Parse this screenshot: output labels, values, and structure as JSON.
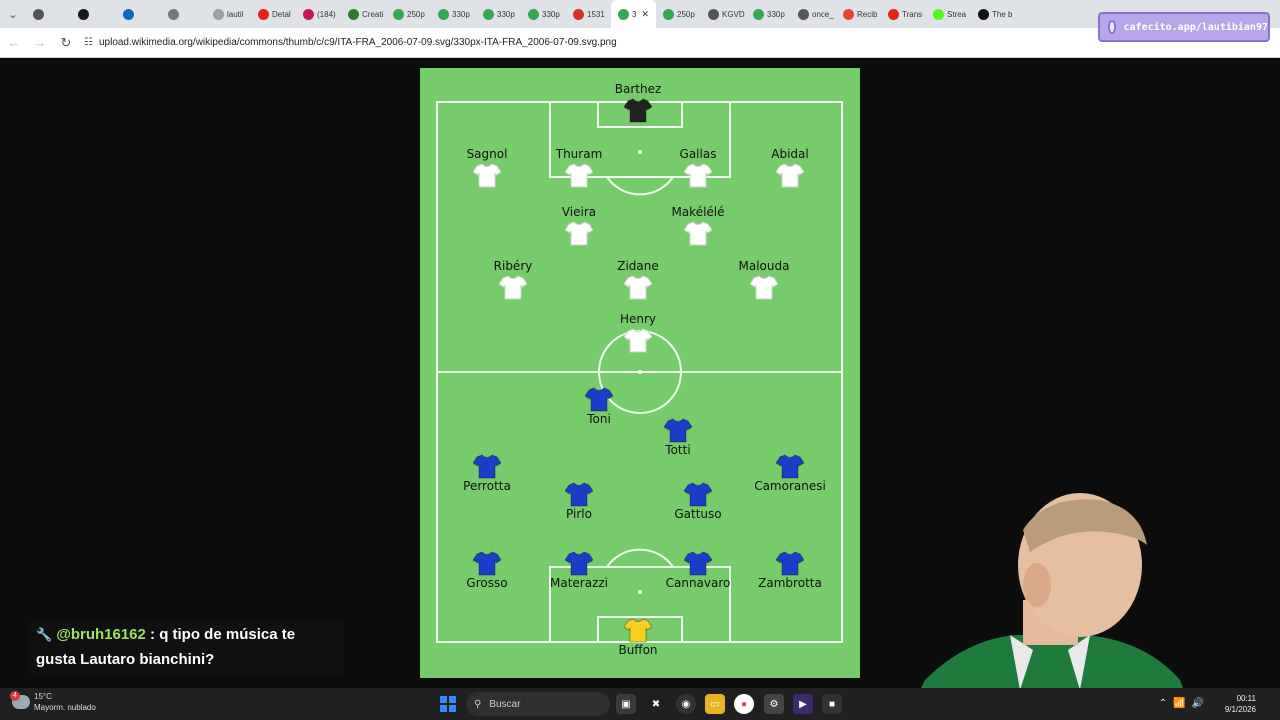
{
  "browser": {
    "tabs": [
      {
        "title": "",
        "icon": "gear-icon",
        "color": "#555555"
      },
      {
        "title": "",
        "icon": "page-icon",
        "color": "#1a1a1a"
      },
      {
        "title": "",
        "icon": "linkedin-icon",
        "color": "#0a66c2"
      },
      {
        "title": "",
        "icon": "info-icon",
        "color": "#777777"
      },
      {
        "title": "lautil",
        "icon": "page-icon",
        "color": "#9aa0a6"
      },
      {
        "title": "Detal",
        "icon": "youtube-icon",
        "color": "#e62117"
      },
      {
        "title": "(184)",
        "icon": "app-icon",
        "color": "#c2185b"
      },
      {
        "title": "Creati",
        "icon": "page-icon",
        "color": "#2e7d32"
      },
      {
        "title": "250p",
        "icon": "wiki-icon",
        "color": "#34a853"
      },
      {
        "title": "330p",
        "icon": "wiki-icon",
        "color": "#34a853"
      },
      {
        "title": "330p",
        "icon": "wiki-icon",
        "color": "#34a853"
      },
      {
        "title": "330p",
        "icon": "wiki-icon",
        "color": "#34a853"
      },
      {
        "title": "1531",
        "icon": "mail-icon",
        "color": "#d93025"
      },
      {
        "title": "3",
        "icon": "wiki-icon",
        "color": "#34a853",
        "active": true
      },
      {
        "title": "250p",
        "icon": "wiki-icon",
        "color": "#34a853"
      },
      {
        "title": "KGVD",
        "icon": "page-icon",
        "color": "#555555"
      },
      {
        "title": "330p",
        "icon": "wiki-icon",
        "color": "#34a853"
      },
      {
        "title": "once_",
        "icon": "page-icon",
        "color": "#555555"
      },
      {
        "title": "Recib",
        "icon": "gmail-icon",
        "color": "#ea4335"
      },
      {
        "title": "Trans",
        "icon": "youtube-icon",
        "color": "#e62117"
      },
      {
        "title": "Strea",
        "icon": "kick-icon",
        "color": "#53fc18"
      },
      {
        "title": "The b",
        "icon": "page-icon",
        "color": "#111111"
      }
    ],
    "url": "upload.wikimedia.org/wikipedia/commons/thumb/c/c9/ITA-FRA_2006-07-09.svg/330px-ITA-FRA_2006-07-09.svg.png"
  },
  "extension_badge": "cafecito.app/lautibian97",
  "lineup": {
    "pitch_color": "#76cb6a",
    "line_color": "#ffffff",
    "players": [
      {
        "name": "Barthez",
        "team": "FRA-GK",
        "shirt_color": "#222222"
      },
      {
        "name": "Sagnol",
        "team": "FRA",
        "shirt_color": "#ffffff"
      },
      {
        "name": "Thuram",
        "team": "FRA",
        "shirt_color": "#ffffff"
      },
      {
        "name": "Gallas",
        "team": "FRA",
        "shirt_color": "#ffffff"
      },
      {
        "name": "Abidal",
        "team": "FRA",
        "shirt_color": "#ffffff"
      },
      {
        "name": "Vieira",
        "team": "FRA",
        "shirt_color": "#ffffff"
      },
      {
        "name": "Makélélé",
        "team": "FRA",
        "shirt_color": "#ffffff"
      },
      {
        "name": "Ribéry",
        "team": "FRA",
        "shirt_color": "#ffffff"
      },
      {
        "name": "Zidane",
        "team": "FRA",
        "shirt_color": "#ffffff"
      },
      {
        "name": "Malouda",
        "team": "FRA",
        "shirt_color": "#ffffff"
      },
      {
        "name": "Henry",
        "team": "FRA",
        "shirt_color": "#ffffff"
      },
      {
        "name": "Toni",
        "team": "ITA",
        "shirt_color": "#1a3ec8"
      },
      {
        "name": "Totti",
        "team": "ITA",
        "shirt_color": "#1a3ec8"
      },
      {
        "name": "Perrotta",
        "team": "ITA",
        "shirt_color": "#1a3ec8"
      },
      {
        "name": "Camoranesi",
        "team": "ITA",
        "shirt_color": "#1a3ec8"
      },
      {
        "name": "Pirlo",
        "team": "ITA",
        "shirt_color": "#1a3ec8"
      },
      {
        "name": "Gattuso",
        "team": "ITA",
        "shirt_color": "#1a3ec8"
      },
      {
        "name": "Grosso",
        "team": "ITA",
        "shirt_color": "#1a3ec8"
      },
      {
        "name": "Materazzi",
        "team": "ITA",
        "shirt_color": "#1a3ec8"
      },
      {
        "name": "Cannavaro",
        "team": "ITA",
        "shirt_color": "#1a3ec8"
      },
      {
        "name": "Zambrotta",
        "team": "ITA",
        "shirt_color": "#1a3ec8"
      },
      {
        "name": "Buffon",
        "team": "ITA-GK",
        "shirt_color": "#f5d020"
      }
    ]
  },
  "chat": {
    "username": "@bruh16162",
    "message": ": q tipo de música te gusta Lautaro bianchini?"
  },
  "taskbar": {
    "weather_temp": "15°C",
    "weather_desc": "Mayorm. nublado",
    "weather_badge": "4",
    "search_placeholder": "Buscar",
    "time": "00:11",
    "date": "9/1/2026"
  }
}
